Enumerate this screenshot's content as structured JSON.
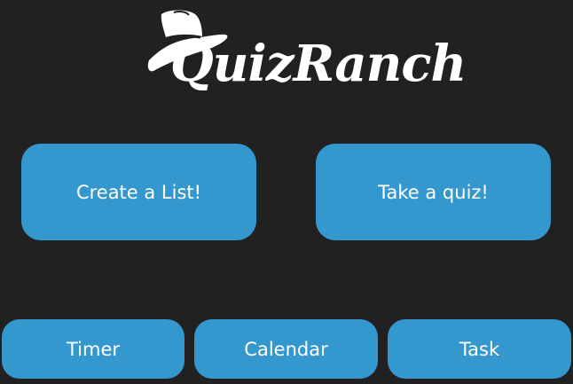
{
  "app": {
    "logo_text": "QuizRanch"
  },
  "main_actions": {
    "create_list_label": "Create a List!",
    "take_quiz_label": "Take a quiz!"
  },
  "bottom_actions": {
    "timer_label": "Timer",
    "calendar_label": "Calendar",
    "task_label": "Task"
  },
  "colors": {
    "background": "#212121",
    "button": "#3498cf",
    "text": "#ffffff"
  },
  "icons": {
    "logo_icon": "cowboy-hat-icon"
  }
}
